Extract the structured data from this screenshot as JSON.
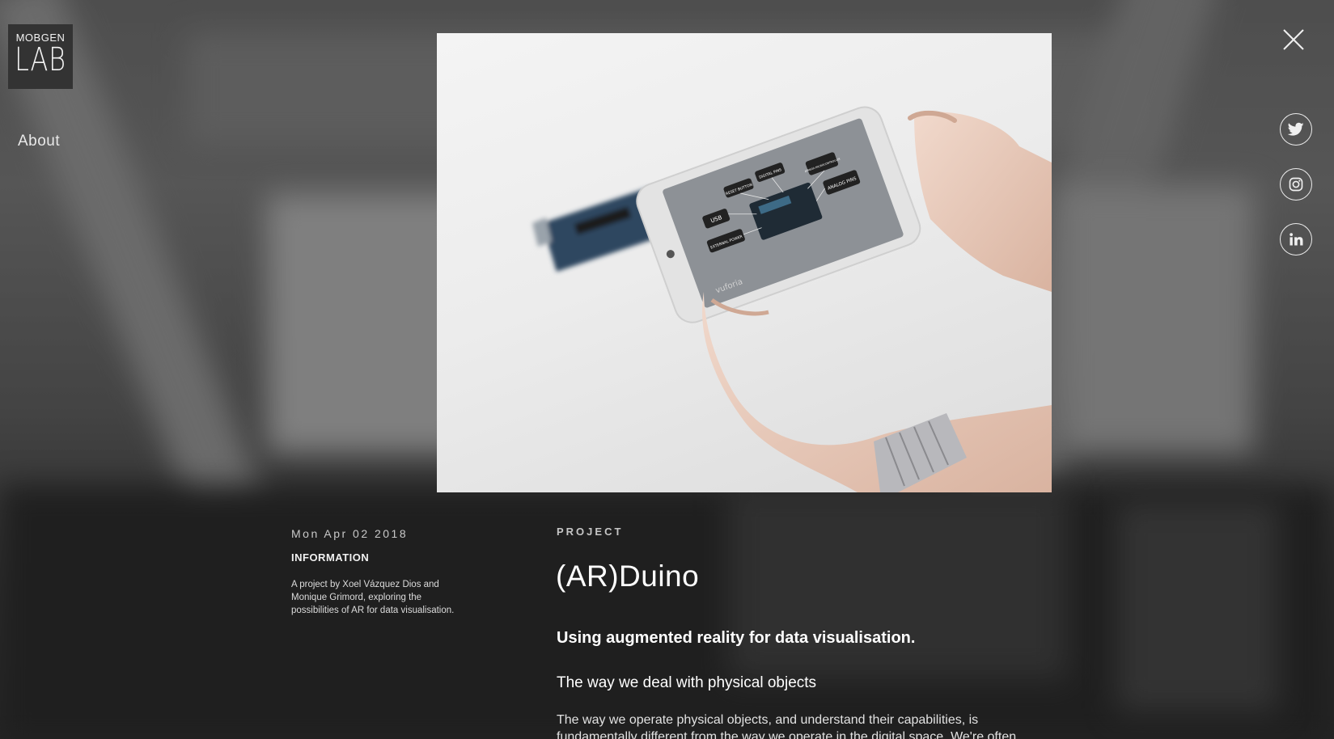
{
  "brand": {
    "logo_top": "MOBGEN",
    "logo_bottom": "LAB"
  },
  "nav": {
    "about": "About"
  },
  "controls": {
    "close_icon": "close-icon"
  },
  "social": [
    {
      "name": "twitter",
      "icon": "twitter-icon"
    },
    {
      "name": "instagram",
      "icon": "instagram-icon"
    },
    {
      "name": "linkedin",
      "icon": "linkedin-icon"
    }
  ],
  "hero": {
    "phone_labels": [
      "USB",
      "RESET BUTTON",
      "DIGITAL PINS",
      "ATMEGA MICROCONTROLLER",
      "ANALOG PINS",
      "EXTERNAL POWER"
    ],
    "phone_watermark": "vuforia"
  },
  "meta": {
    "date": "Mon Apr 02 2018",
    "heading": "INFORMATION",
    "description": "A project by Xoel Vázquez Dios and Monique Grimord, exploring the possibilities of AR for data visualisation."
  },
  "article": {
    "kicker": "PROJECT",
    "title": "(AR)Duino",
    "subtitle": "Using augmented reality for data visualisation.",
    "section_heading": "The way we deal with physical objects",
    "body": "The way we operate physical objects, and understand their capabilities, is fundamentally different from the way we operate in the digital space. We're often"
  },
  "colors": {
    "overlay": "#1a1a1a",
    "text": "#ffffff",
    "logo_bg": "#333333"
  }
}
